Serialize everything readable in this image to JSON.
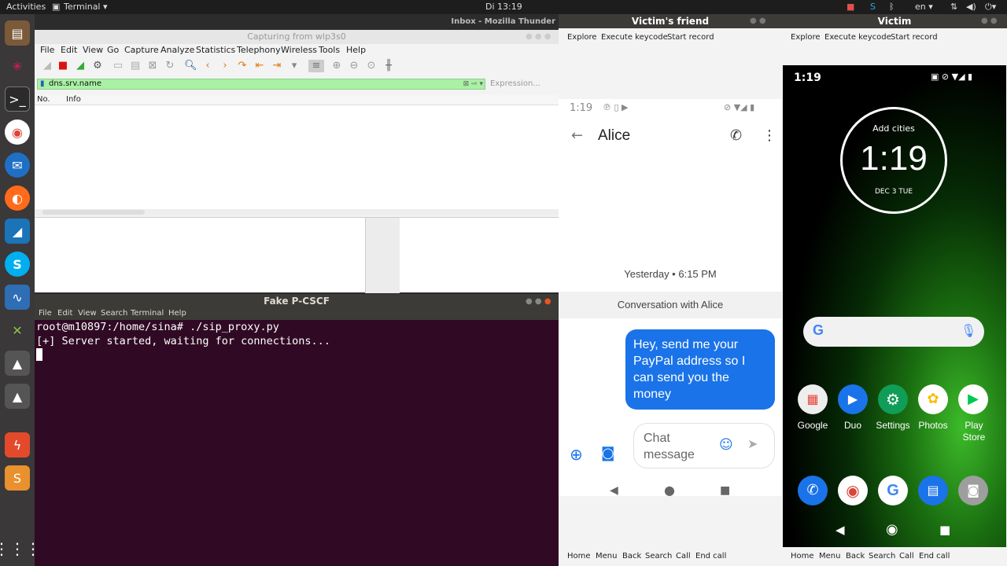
{
  "topbar": {
    "activities": "Activities",
    "app": "Terminal ▾",
    "clock": "Di 13:19",
    "lang": "en ▾"
  },
  "bg_window": {
    "title": "Inbox - Mozilla Thunder"
  },
  "wireshark": {
    "title": "Capturing from wlp3s0",
    "menu": [
      "File",
      "Edit",
      "View",
      "Go",
      "Capture",
      "Analyze",
      "Statistics",
      "Telephony",
      "Wireless",
      "Tools",
      "Help"
    ],
    "filter": "dns.srv.name",
    "expression": "Expression...",
    "columns": [
      "No.",
      "Info"
    ]
  },
  "terminal": {
    "title": "Fake P-CSCF",
    "menu": [
      "File",
      "Edit",
      "View",
      "Search",
      "Terminal",
      "Help"
    ],
    "lines": [
      "root@m10897:/home/sina# ./sip_proxy.py",
      "[+] Server started, waiting for connections..."
    ]
  },
  "friend": {
    "title": "Victim's friend",
    "toolbar": [
      "Explore",
      "Execute keycode",
      "Start record"
    ],
    "status_time": "1:19",
    "contact": "Alice",
    "date": "Yesterday • 6:15 PM",
    "conversation": "Conversation with Alice",
    "message": "Hey, send me your PayPal address so I can send you the money",
    "input_placeholder": "Chat message",
    "footer": [
      "Home",
      "Menu",
      "Back",
      "Search",
      "Call",
      "End call"
    ]
  },
  "victim": {
    "title": "Victim",
    "toolbar": [
      "Explore",
      "Execute keycode",
      "Start record"
    ],
    "status_time": "1:19",
    "clock_label": "Add cities",
    "clock_time": "1:19",
    "clock_date": "DEC 3 TUE",
    "apps": [
      "Google",
      "Duo",
      "Settings",
      "Photos",
      "Play Store"
    ],
    "footer": [
      "Home",
      "Menu",
      "Back",
      "Search",
      "Call",
      "End call"
    ]
  },
  "colors": {
    "ubuntu_terminal": "#300a24",
    "filter_green": "#a9f1a5",
    "bubble_blue": "#1a73e8"
  }
}
